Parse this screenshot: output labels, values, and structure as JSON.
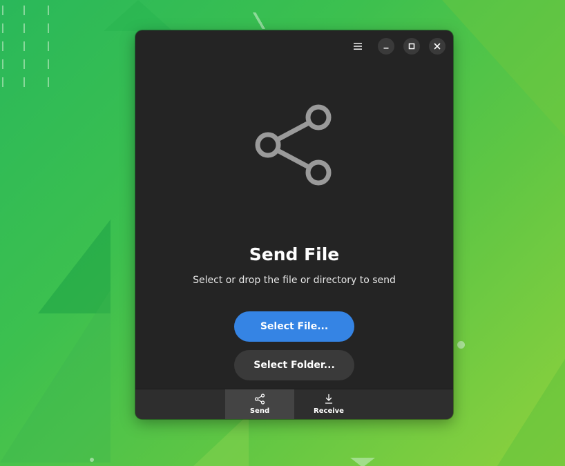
{
  "window": {
    "controls": {
      "menu_icon": "hamburger-menu-icon",
      "minimize_icon": "minimize-icon",
      "maximize_icon": "maximize-icon",
      "close_icon": "close-icon"
    }
  },
  "main": {
    "hero_icon": "share-icon",
    "title": "Send File",
    "subtitle": "Select or drop the file or directory to send",
    "primary_button": "Select File...",
    "secondary_button": "Select Folder..."
  },
  "view_switcher": {
    "items": [
      {
        "label": "Send",
        "icon": "share-icon",
        "active": true
      },
      {
        "label": "Receive",
        "icon": "download-icon",
        "active": false
      }
    ]
  },
  "colors": {
    "accent": "#3584e4",
    "window_bg": "#242424",
    "button_secondary": "#3a3a3a",
    "active_tab": "#444444",
    "icon_gray": "#9a9a9a"
  }
}
